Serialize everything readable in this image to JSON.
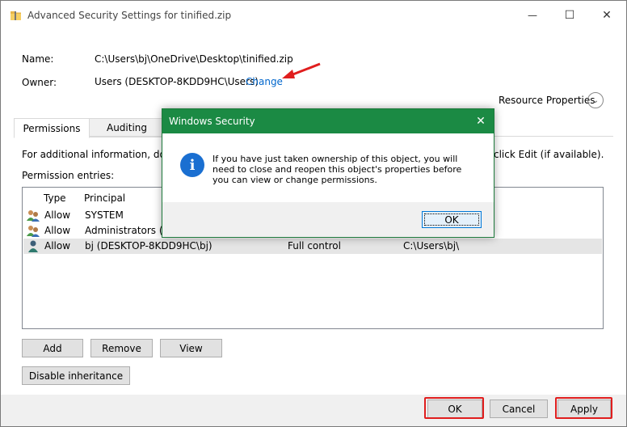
{
  "window": {
    "title": "Advanced Security Settings for tinified.zip",
    "minimize": "—",
    "maximize": "☐",
    "close": "✕"
  },
  "info": {
    "name_label": "Name:",
    "name_value": "C:\\Users\\bj\\OneDrive\\Desktop\\tinified.zip",
    "owner_label": "Owner:",
    "owner_value": "Users (DESKTOP-8KDD9HC\\Users)",
    "change_link": "Change",
    "resource_properties": "Resource Properties"
  },
  "tabs": [
    {
      "label": "Permissions"
    },
    {
      "label": "Auditing"
    }
  ],
  "panel": {
    "info_text_left": "For additional information, doub",
    "info_text_right": "click Edit (if available).",
    "entries_label": "Permission entries:",
    "columns": {
      "type": "Type",
      "principal": "Principal"
    },
    "rows": [
      {
        "type": "Allow",
        "principal": "SYSTEM",
        "access": "",
        "inherited": ""
      },
      {
        "type": "Allow",
        "principal": "Administrators (DE",
        "access": "",
        "inherited": ""
      },
      {
        "type": "Allow",
        "principal": "bj (DESKTOP-8KDD9HC\\bj)",
        "access": "Full control",
        "inherited": "C:\\Users\\bj\\"
      }
    ]
  },
  "buttons": {
    "add": "Add",
    "remove": "Remove",
    "view": "View",
    "disable_inheritance": "Disable inheritance",
    "ok": "OK",
    "cancel": "Cancel",
    "apply": "Apply"
  },
  "dialog": {
    "title": "Windows Security",
    "close": "✕",
    "icon": "i",
    "message": "If you have just taken ownership of this object, you will need to close and reopen this object's properties before you can view or change permissions.",
    "ok": "OK"
  },
  "colors": {
    "dialog_title_bg": "#1b8a44",
    "link": "#0066cc",
    "highlight_box": "#e01e1e",
    "info_icon": "#1a6fd1"
  }
}
